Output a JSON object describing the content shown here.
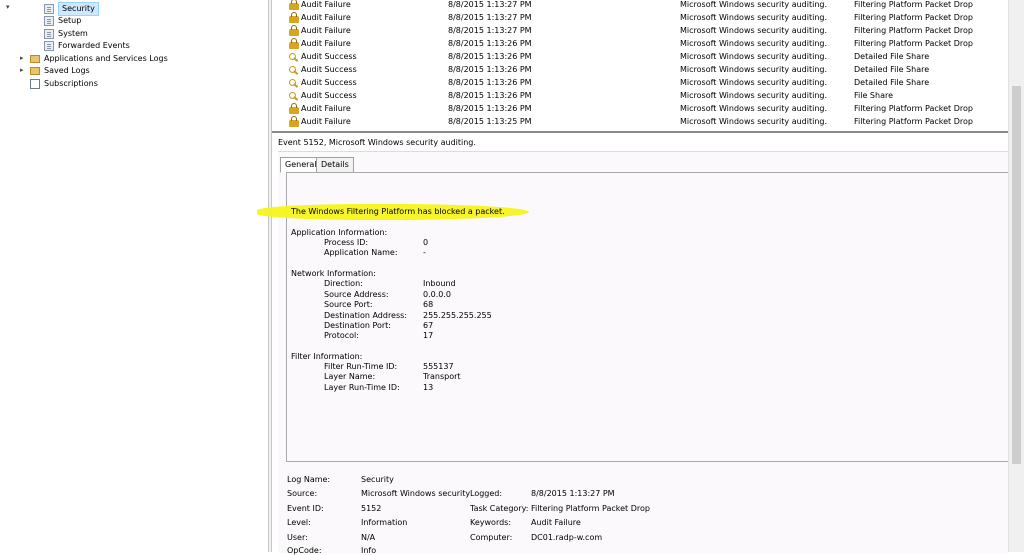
{
  "tree": {
    "items": [
      {
        "label": "Security",
        "selected": true
      },
      {
        "label": "Setup"
      },
      {
        "label": "System"
      },
      {
        "label": "Forwarded Events"
      },
      {
        "label": "Applications and Services Logs"
      },
      {
        "label": "Saved Logs"
      },
      {
        "label": "Subscriptions"
      }
    ]
  },
  "event_list": {
    "rows": [
      {
        "keyword": "Audit Failure",
        "icon": "lock-icon",
        "datetime": "8/8/2015 1:13:27 PM",
        "source": "Microsoft Windows security auditing.",
        "category": "Filtering Platform Packet Drop"
      },
      {
        "keyword": "Audit Failure",
        "icon": "lock-icon",
        "datetime": "8/8/2015 1:13:27 PM",
        "source": "Microsoft Windows security auditing.",
        "category": "Filtering Platform Packet Drop"
      },
      {
        "keyword": "Audit Failure",
        "icon": "lock-icon",
        "datetime": "8/8/2015 1:13:27 PM",
        "source": "Microsoft Windows security auditing.",
        "category": "Filtering Platform Packet Drop"
      },
      {
        "keyword": "Audit Failure",
        "icon": "lock-icon",
        "datetime": "8/8/2015 1:13:26 PM",
        "source": "Microsoft Windows security auditing.",
        "category": "Filtering Platform Packet Drop"
      },
      {
        "keyword": "Audit Success",
        "icon": "key-icon",
        "datetime": "8/8/2015 1:13:26 PM",
        "source": "Microsoft Windows security auditing.",
        "category": "Detailed File Share"
      },
      {
        "keyword": "Audit Success",
        "icon": "key-icon",
        "datetime": "8/8/2015 1:13:26 PM",
        "source": "Microsoft Windows security auditing.",
        "category": "Detailed File Share"
      },
      {
        "keyword": "Audit Success",
        "icon": "key-icon",
        "datetime": "8/8/2015 1:13:26 PM",
        "source": "Microsoft Windows security auditing.",
        "category": "Detailed File Share"
      },
      {
        "keyword": "Audit Success",
        "icon": "key-icon",
        "datetime": "8/8/2015 1:13:26 PM",
        "source": "Microsoft Windows security auditing.",
        "category": "File Share"
      },
      {
        "keyword": "Audit Failure",
        "icon": "lock-icon",
        "datetime": "8/8/2015 1:13:26 PM",
        "source": "Microsoft Windows security auditing.",
        "category": "Filtering Platform Packet Drop"
      },
      {
        "keyword": "Audit Failure",
        "icon": "lock-icon",
        "datetime": "8/8/2015 1:13:25 PM",
        "source": "Microsoft Windows security auditing.",
        "category": "Filtering Platform Packet Drop"
      }
    ]
  },
  "detail": {
    "title": "Event 5152, Microsoft Windows security auditing.",
    "tabs": [
      "General",
      "Details"
    ],
    "message": "The Windows Filtering Platform has blocked a packet.",
    "highlight_color": "#f7f41b",
    "sections": {
      "app_header": "Application Information:",
      "app": [
        {
          "k": "Process ID:",
          "v": "0"
        },
        {
          "k": "Application Name:",
          "v": "-"
        }
      ],
      "net_header": "Network Information:",
      "net": [
        {
          "k": "Direction:",
          "v": "Inbound"
        },
        {
          "k": "Source Address:",
          "v": "0.0.0.0"
        },
        {
          "k": "Source Port:",
          "v": "68"
        },
        {
          "k": "Destination Address:",
          "v": "255.255.255.255"
        },
        {
          "k": "Destination Port:",
          "v": "67"
        },
        {
          "k": "Protocol:",
          "v": "17"
        }
      ],
      "filter_header": "Filter Information:",
      "filter": [
        {
          "k": "Filter Run-Time ID:",
          "v": "555137"
        },
        {
          "k": "Layer Name:",
          "v": "Transport"
        },
        {
          "k": "Layer Run-Time ID:",
          "v": "13"
        }
      ]
    },
    "props": {
      "log_name_label": "Log Name:",
      "log_name": "Security",
      "source_label": "Source:",
      "source": "Microsoft Windows security",
      "logged_label": "Logged:",
      "logged": "8/8/2015 1:13:27 PM",
      "event_id_label": "Event ID:",
      "event_id": "5152",
      "task_category_label": "Task Category:",
      "task_category": "Filtering Platform Packet Drop",
      "level_label": "Level:",
      "level": "Information",
      "keywords_label": "Keywords:",
      "keywords": "Audit Failure",
      "user_label": "User:",
      "user": "N/A",
      "computer_label": "Computer:",
      "computer": "DC01.radp-w.com",
      "opcode_label": "OpCode:",
      "opcode": "Info"
    }
  }
}
